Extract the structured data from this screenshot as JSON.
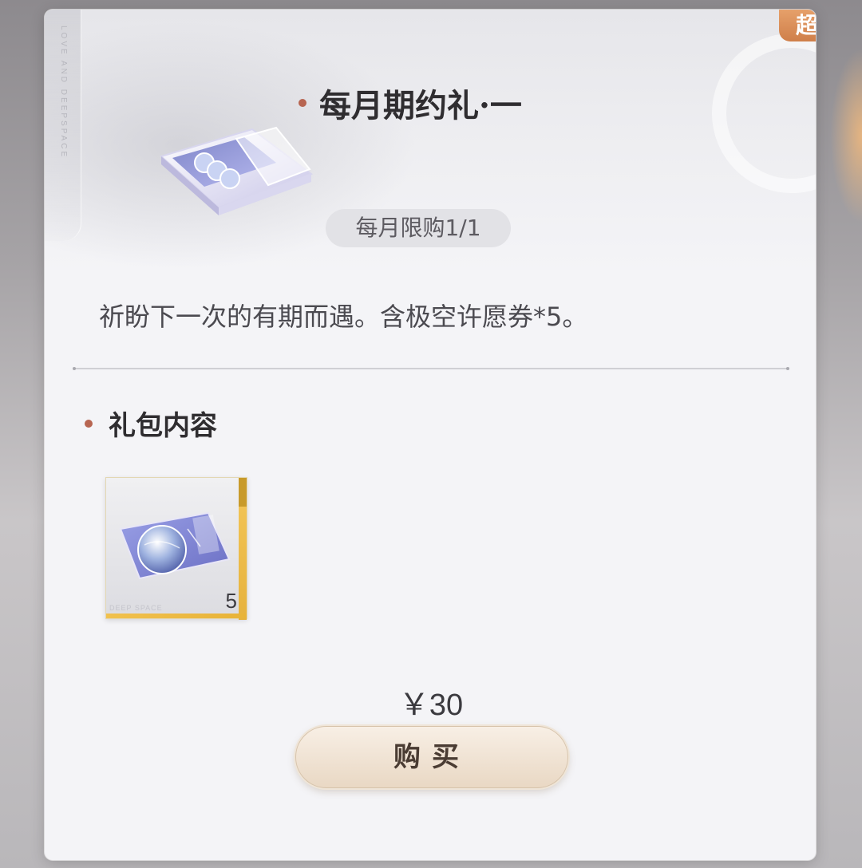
{
  "badge": {
    "label": "超值"
  },
  "side_brand": {
    "text": "LOVE AND DEEPSPACE"
  },
  "pack": {
    "title": "每月期约礼·一",
    "limit": "每月限购1/1",
    "description": "祈盼下一次的有期而遇。含极空许愿券*5。"
  },
  "contents": {
    "heading": "礼包内容",
    "items": [
      {
        "count": "5",
        "brand": "DEEP SPACE",
        "icon": "wish-ticket-icon"
      }
    ]
  },
  "purchase": {
    "price": "￥30",
    "button_label": "购买"
  },
  "colors": {
    "accent_dot": "#b76551",
    "badge": "#d98c56",
    "button": "#efe2d1"
  }
}
